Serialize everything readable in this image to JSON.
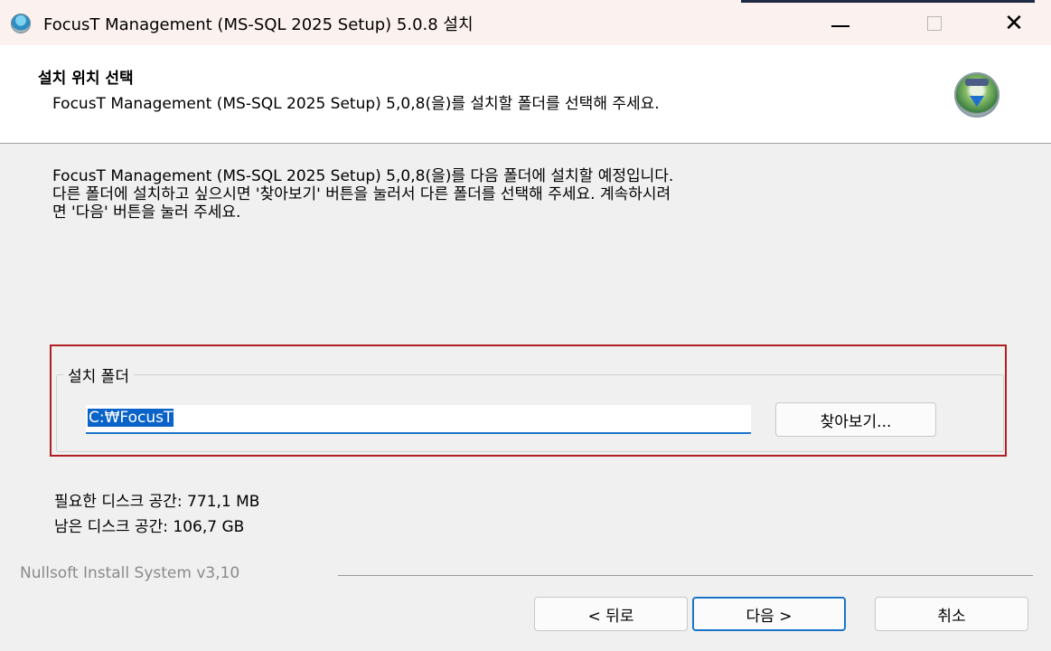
{
  "window": {
    "title": "FocusT Management (MS-SQL 2025 Setup) 5.0.8 설치",
    "close_symbol": "✕"
  },
  "header": {
    "title": "설치 위치 선택",
    "subtitle": "FocusT Management (MS-SQL 2025 Setup) 5,0,8(을)를 설치할 폴더를 선택해 주세요."
  },
  "description": {
    "line1": "FocusT Management (MS-SQL 2025 Setup) 5,0,8(을)를 다음 폴더에 설치할 예정입니다.",
    "line2": "다른 폴더에 설치하고 싶으시면 '찾아보기' 버튼을 눌러서 다른 폴더를 선택해 주세요. 계속하시려",
    "line3": "면 '다음' 버튼을 눌러 주세요."
  },
  "install_folder": {
    "group_label": "설치 폴더",
    "path_value": "C:₩FocusT",
    "browse_label": "찾아보기..."
  },
  "disk": {
    "required": "필요한 디스크 공간: 771,1 MB",
    "available": "남은 디스크 공간: 106,7 GB"
  },
  "footer": {
    "branding": "Nullsoft Install System v3,10",
    "back_label": "< 뒤로",
    "next_label": "다음 >",
    "cancel_label": "취소"
  },
  "colors": {
    "highlight_border": "#b11e22",
    "focus_accent": "#1a73c9"
  }
}
